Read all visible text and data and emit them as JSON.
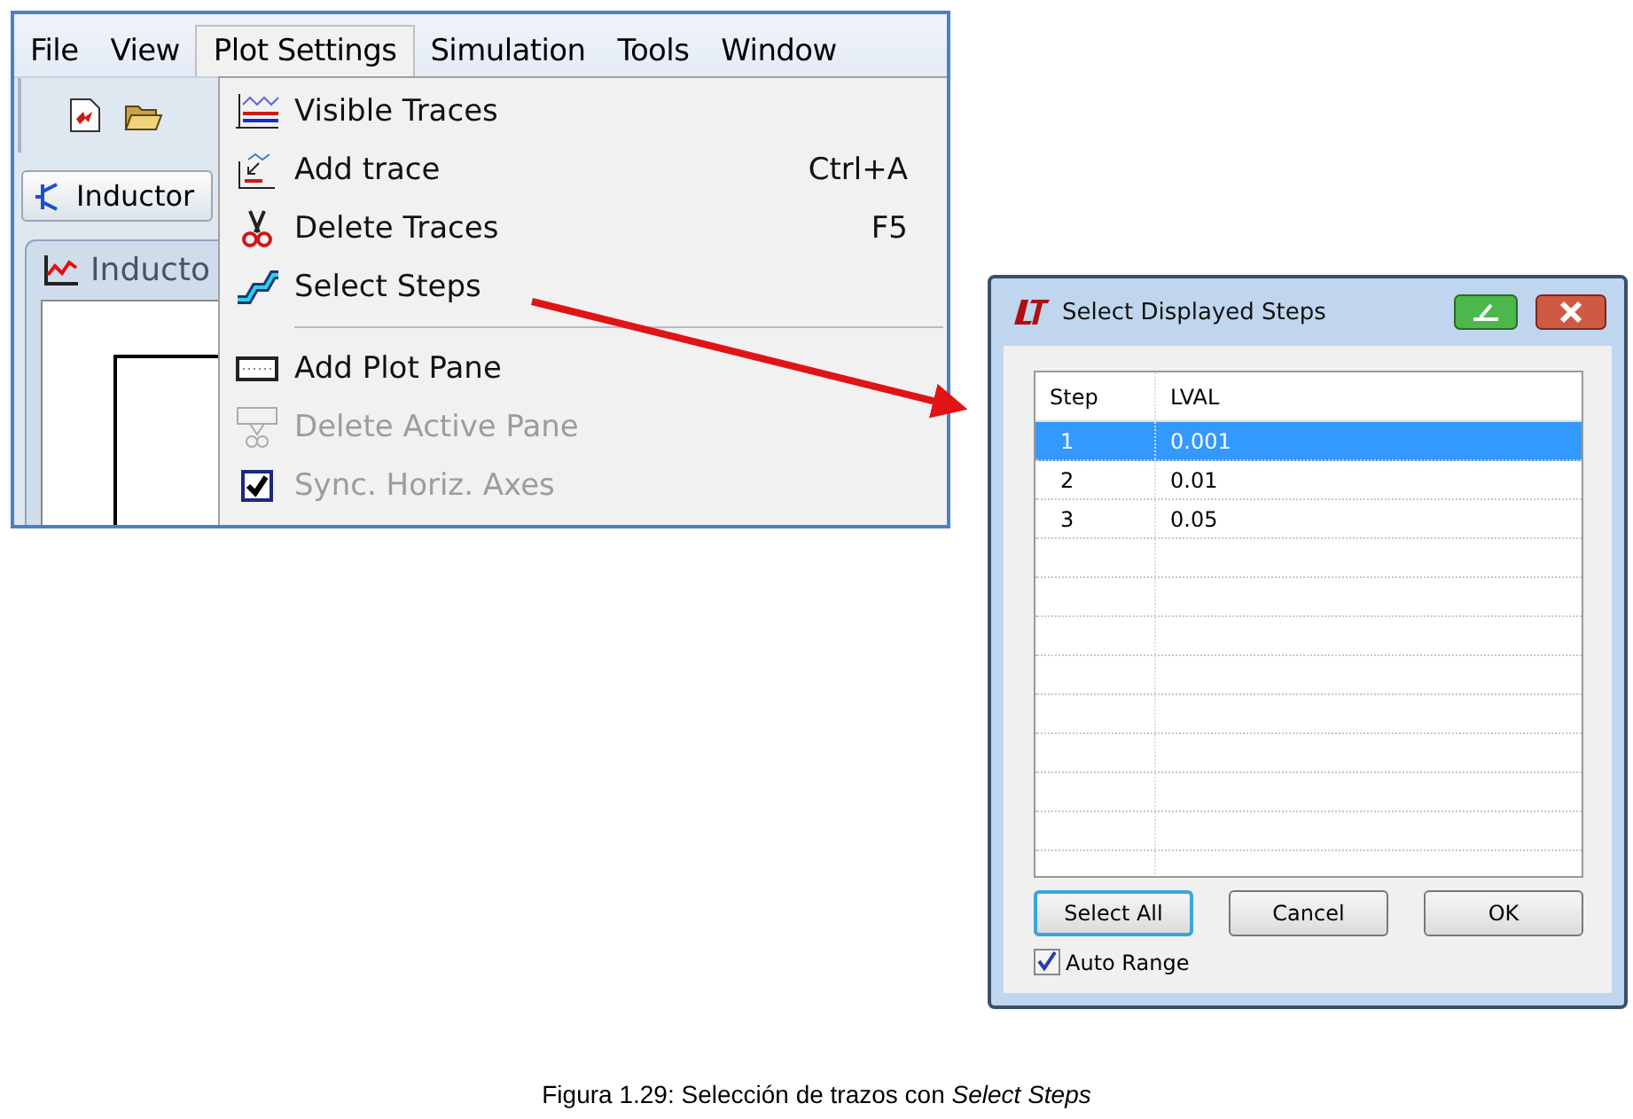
{
  "app": {
    "menu_bar": [
      {
        "label": "File",
        "selected": false
      },
      {
        "label": "View",
        "selected": false
      },
      {
        "label": "Plot Settings",
        "selected": true
      },
      {
        "label": "Simulation",
        "selected": false
      },
      {
        "label": "Tools",
        "selected": false
      },
      {
        "label": "Window",
        "selected": false
      }
    ],
    "schematic_tab": "Inductor",
    "plot_window_title": "Inducto",
    "menu": [
      {
        "kind": "item",
        "label": "Visible Traces",
        "disabled": false
      },
      {
        "kind": "item",
        "label": "Add trace",
        "shortcut": "Ctrl+A",
        "disabled": false
      },
      {
        "kind": "item",
        "label": "Delete Traces",
        "shortcut": "F5",
        "disabled": false
      },
      {
        "kind": "item",
        "label": "Select Steps",
        "disabled": false
      },
      {
        "kind": "separator"
      },
      {
        "kind": "item",
        "label": "Add Plot Pane",
        "disabled": false
      },
      {
        "kind": "item",
        "label": "Delete Active Pane",
        "disabled": true
      },
      {
        "kind": "check",
        "label": "Sync. Horiz. Axes",
        "checked": true,
        "disabled": true
      }
    ]
  },
  "dialog": {
    "title": "Select Displayed Steps",
    "columns": [
      "Step",
      "LVAL"
    ],
    "rows": [
      {
        "step": "1",
        "value": "0.001",
        "selected": true
      },
      {
        "step": "2",
        "value": "0.01",
        "selected": false
      },
      {
        "step": "3",
        "value": "0.05",
        "selected": false
      }
    ],
    "buttons": [
      {
        "label": "Select All",
        "focused": true
      },
      {
        "label": "Cancel",
        "focused": false
      },
      {
        "label": "OK",
        "focused": false
      }
    ],
    "auto_range": {
      "label": "Auto Range",
      "checked": true
    }
  },
  "caption": "Figura 1.29: Selección de trazos con *Select Steps*"
}
